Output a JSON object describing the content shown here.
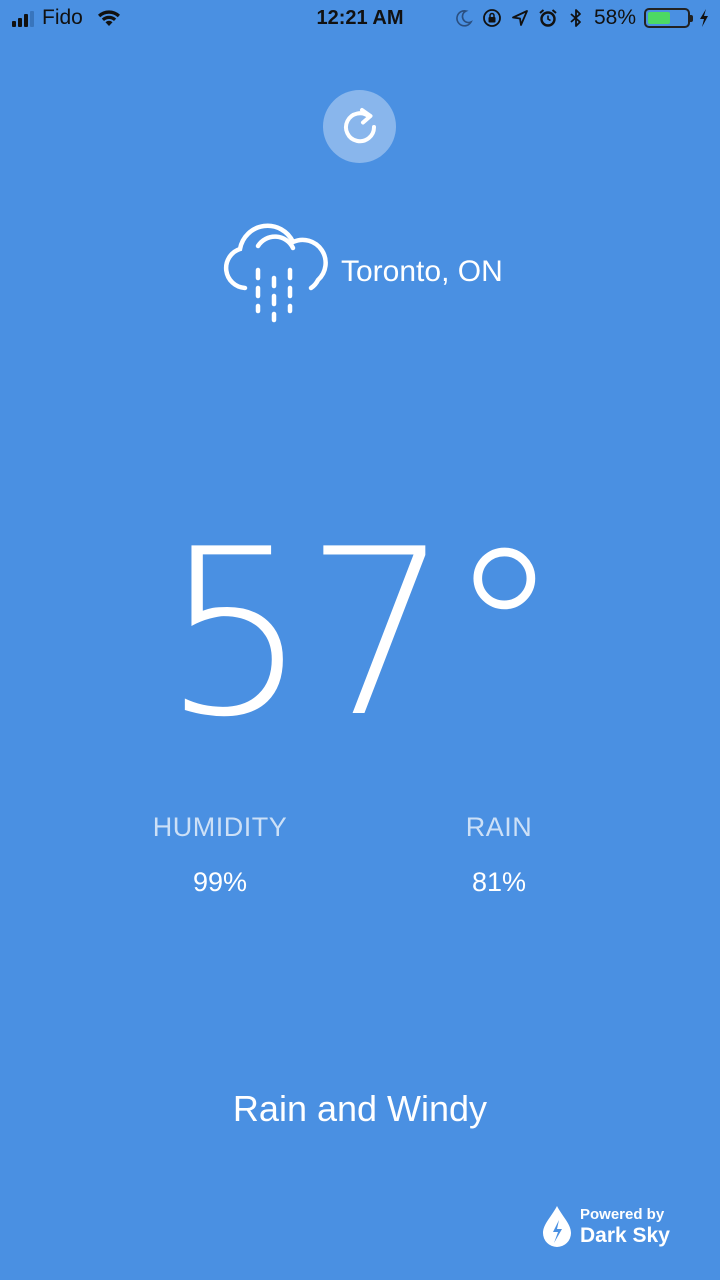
{
  "status_bar": {
    "carrier": "Fido",
    "time": "12:21 AM",
    "battery_percent": "58%",
    "battery_level": 0.58,
    "icons": [
      "signal-icon",
      "wifi-icon",
      "moon-icon",
      "orientation-lock-icon",
      "location-icon",
      "alarm-icon",
      "bluetooth-icon",
      "battery-icon",
      "charging-icon"
    ]
  },
  "weather": {
    "location": "Toronto, ON",
    "condition_icon": "rain-cloud-icon",
    "temperature": "57",
    "degree_symbol": "°",
    "humidity_label": "HUMIDITY",
    "humidity_value": "99%",
    "rain_label": "RAIN",
    "rain_value": "81%",
    "summary": "Rain and Windy"
  },
  "footer": {
    "powered_by": "Powered by",
    "brand": "Dark Sky"
  },
  "colors": {
    "background": "#4a90e2",
    "text": "#ffffff",
    "battery_fill": "#4cd964"
  }
}
